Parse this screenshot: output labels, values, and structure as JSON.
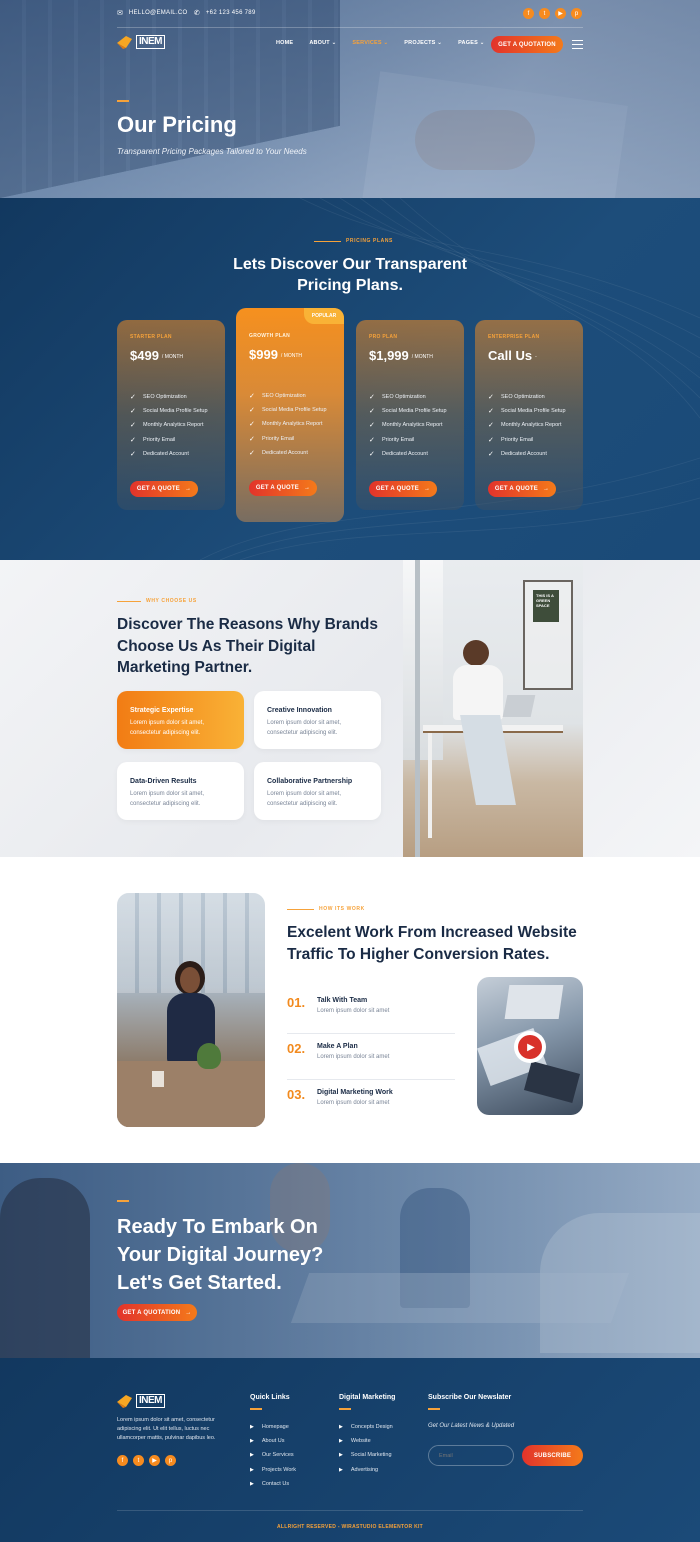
{
  "topbar": {
    "email": "HELLO@EMAIL.CO",
    "phone": "+62 123 456 789",
    "socials": [
      "facebook-icon",
      "twitter-icon",
      "youtube-icon",
      "pinterest-icon"
    ]
  },
  "nav": {
    "logo": "INEM",
    "items": [
      {
        "label": "HOME",
        "dropdown": false
      },
      {
        "label": "ABOUT",
        "dropdown": true
      },
      {
        "label": "SERVICES",
        "dropdown": true,
        "active": true
      },
      {
        "label": "PROJECTS",
        "dropdown": true
      },
      {
        "label": "PAGES",
        "dropdown": true
      }
    ],
    "cta": "GET A QUOTATION"
  },
  "hero": {
    "title": "Our Pricing",
    "subtitle": "Transparent Pricing Packages Tailored to Your Needs"
  },
  "pricing": {
    "label": "PRICING PLANS",
    "title_line1": "Lets Discover Our Transparent",
    "title_line2": "Pricing Plans.",
    "popular_badge": "POPULAR",
    "plans": [
      {
        "name": "STARTER PLAN",
        "price": "$499",
        "per": "/ MONTH",
        "features": [
          "SEO Optimization",
          "Social Media Profile Setup",
          "Monthly Analytics Report",
          "Priority Email",
          "Dedicated Account"
        ],
        "button": "GET A QUOTE"
      },
      {
        "name": "GROWTH PLAN",
        "price": "$999",
        "per": "/ MONTH",
        "features": [
          "SEO Optimization",
          "Social Media Profile Setup",
          "Monthly Analytics Report",
          "Priority Email",
          "Dedicated Account"
        ],
        "button": "GET A QUOTE"
      },
      {
        "name": "PRO PLAN",
        "price": "$1,999",
        "per": "/ MONTH",
        "features": [
          "SEO Optimization",
          "Social Media Profile Setup",
          "Monthly Analytics Report",
          "Priority Email",
          "Dedicated Account"
        ],
        "button": "GET A QUOTE"
      },
      {
        "name": "ENTERPRISE PLAN",
        "price": "Call Us",
        "per": "-",
        "features": [
          "SEO Optimization",
          "Social Media Profile Setup",
          "Monthly Analytics Report",
          "Priority Email",
          "Dedicated Account"
        ],
        "button": "GET A QUOTE"
      }
    ],
    "colors": {
      "accent": "#f68b1f",
      "bg": "#12385f"
    }
  },
  "why": {
    "label": "WHY CHOOSE US",
    "title_line1": "Discover The Reasons Why Brands",
    "title_line2": "Choose Us As Their Digital",
    "title_line3": "Marketing Partner.",
    "features": [
      {
        "title": "Strategic Expertise",
        "desc": "Lorem ipsum dolor sit amet, consectetur adipiscing elit."
      },
      {
        "title": "Creative Innovation",
        "desc": "Lorem ipsum dolor sit amet, consectetur adipiscing elit."
      },
      {
        "title": "Data-Driven Results",
        "desc": "Lorem ipsum dolor sit amet, consectetur adipiscing elit."
      },
      {
        "title": "Collaborative Partnership",
        "desc": "Lorem ipsum dolor sit amet, consectetur adipiscing elit."
      }
    ],
    "sign_text": "THIS IS A GREEN SPACE"
  },
  "how": {
    "label": "HOW ITS WORK",
    "title_line1": "Excelent Work From Increased Website",
    "title_line2": "Traffic To Higher Conversion Rates.",
    "steps": [
      {
        "num": "01.",
        "title": "Talk With Team",
        "desc": "Lorem ipsum dolor sit amet"
      },
      {
        "num": "02.",
        "title": "Make A Plan",
        "desc": "Lorem ipsum dolor sit amet"
      },
      {
        "num": "03.",
        "title": "Digital Marketing Work",
        "desc": "Lorem ipsum dolor sit amet"
      }
    ]
  },
  "cta": {
    "line1": "Ready To Embark On",
    "line2": "Your Digital Journey?",
    "line3": "Let's Get Started.",
    "button": "GET A QUOTATION"
  },
  "footer": {
    "logo": "INEM",
    "about": "Lorem ipsum dolor sit amet, consectetur adipiscing elit. Ut elit tellus, luctus nec ullamcorper mattis, pulvinar dapibus leo.",
    "quick_links_title": "Quick Links",
    "quick_links": [
      "Homepage",
      "About Us",
      "Our Services",
      "Projects Work",
      "Contact Us"
    ],
    "digital_title": "Digital Marketing",
    "digital_links": [
      "Concepts Design",
      "Website",
      "Social Marketing",
      "Advertising"
    ],
    "newsletter_title": "Subscribe Our Newslater",
    "newsletter_sub": "Get Our Latest News & Updated",
    "email_placeholder": "Email",
    "subscribe": "SUBSCRIBE",
    "copyright": "ALLRIGHT RESERVED - WIRASTUDIO ELEMENTOR KIT"
  }
}
